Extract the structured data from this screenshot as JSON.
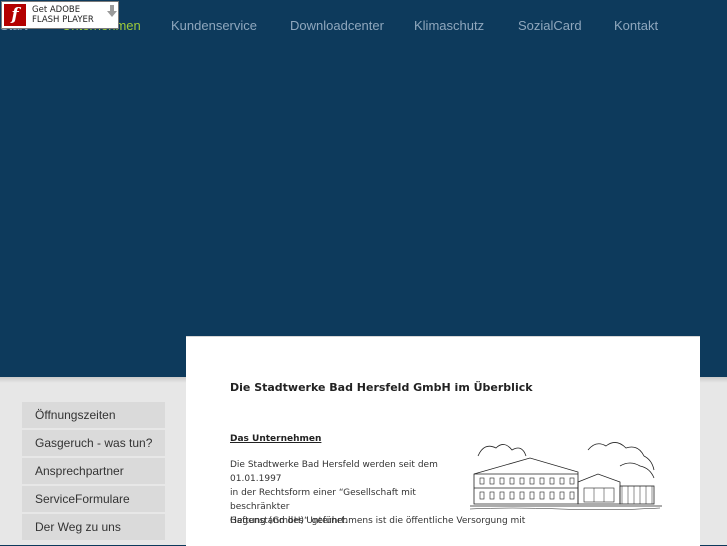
{
  "flash_badge": {
    "line1": "Get ADOBE",
    "line2": "FLASH PLAYER",
    "logo_letter": "f"
  },
  "nav": [
    {
      "label": "Start"
    },
    {
      "label": "Unternehmen"
    },
    {
      "label": "Kundenservice"
    },
    {
      "label": "Downloadcenter"
    },
    {
      "label": "Klimaschutz"
    },
    {
      "label": "SozialCard"
    },
    {
      "label": "Kontakt"
    }
  ],
  "sidebar": [
    {
      "label": "Öffnungszeiten"
    },
    {
      "label": "Gasgeruch - was tun?"
    },
    {
      "label": "Ansprechpartner"
    },
    {
      "label": "ServiceFormulare"
    },
    {
      "label": "Der Weg zu uns"
    }
  ],
  "content": {
    "title": "Die Stadtwerke Bad Hersfeld GmbH im Überblick",
    "section_title": "Das Unternehmen",
    "paragraph_lines": [
      "Die Stadtwerke Bad Hersfeld werden seit dem 01.01.1997",
      "in der Rechtsform einer “Gesellschaft mit beschränkter",
      "Haftung (GmbH)“ geführt."
    ],
    "paragraph2": "Gegenstand des Unternehmens ist die öffentliche Versorgung mit"
  },
  "colors": {
    "background": "#0d3a5c",
    "nav_text": "#8fa7bd",
    "nav_active": "#9fcb3a",
    "sidebar_bg": "#dadada"
  }
}
